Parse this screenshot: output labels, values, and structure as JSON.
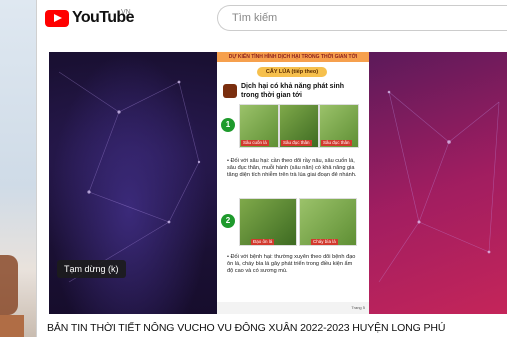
{
  "header": {
    "logo_word": "YouTube",
    "region": "VN",
    "search_placeholder": "Tìm kiếm"
  },
  "player": {
    "tooltip": "Tạm dừng (k)"
  },
  "slide": {
    "header": "DỰ KIẾN TÌNH HÌNH DỊCH HẠI TRONG THỜI GIAN TỚI",
    "subtitle": "CÂY LÚA (tiếp theo)",
    "title": "Dịch hại có khả năng phát sinh trong thời gian tới",
    "group1_number": "1",
    "group2_number": "2",
    "pic_labels": [
      "Sâu cuốn lá",
      "Sâu đục thân",
      "Sâu đục thân"
    ],
    "pic_labels2": [
      "Đạo ôn lá",
      "Cháy bìa lá"
    ],
    "bullet1": "• Đối với sâu hại: cần theo dõi rầy nâu, sâu cuốn lá, sâu đục thân, muỗi hành (sâu năn) có khả năng gia tăng diện tích nhiễm trên trà lúa giai đoạn đẻ nhánh.",
    "bullet2": "• Đối với bệnh hại: thường xuyên theo dõi bệnh đạo ôn lá, cháy bìa lá gây phát triển trong điều kiện ẩm độ cao và có sương mù.",
    "page": "Trang  5"
  },
  "video": {
    "title": "BẢN TIN THỜI TIẾT NÔNG VUCHO VU ĐÔNG XUÂN 2022-2023 HUYỆN LONG PHÚ"
  },
  "colors": {
    "brand_red": "#ff0000",
    "slide_header": "#f6a04d",
    "step_green": "#1e9a2c"
  }
}
